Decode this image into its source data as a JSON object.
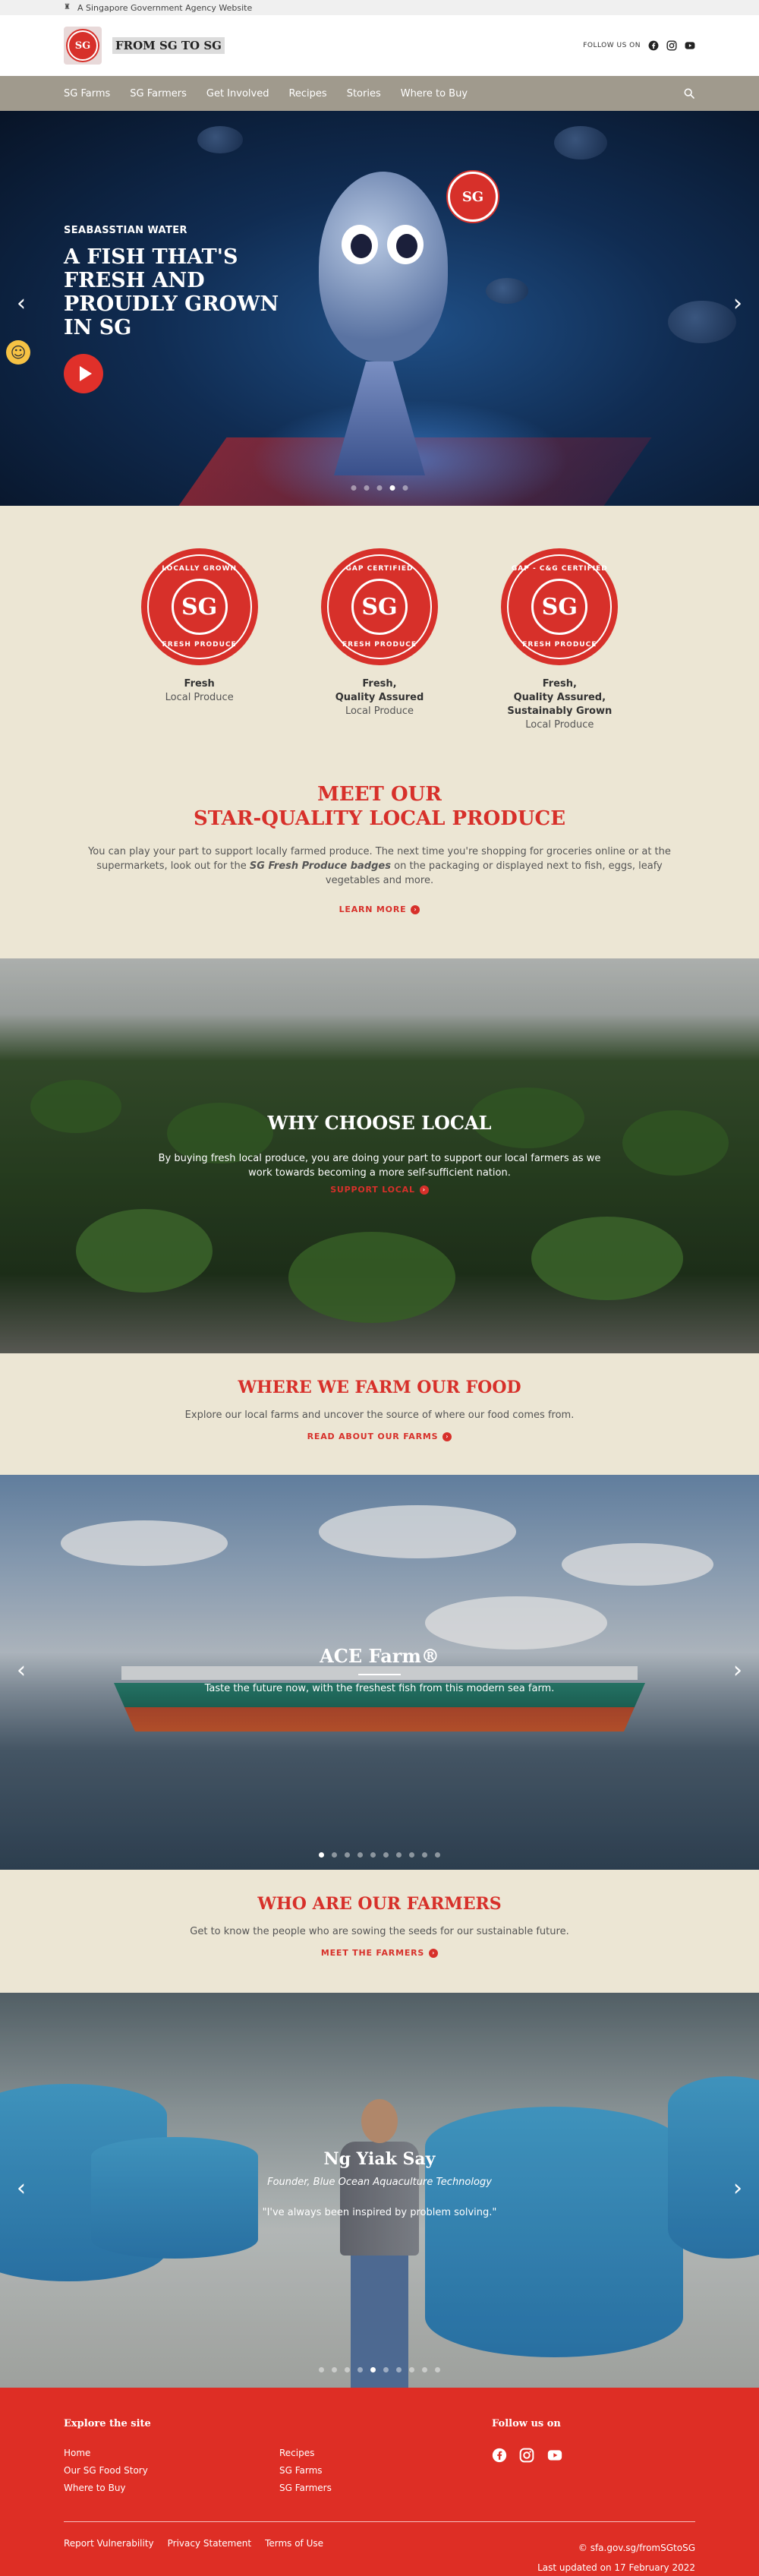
{
  "gov_bar": {
    "text": "A Singapore Government Agency Website"
  },
  "header": {
    "logo_text": "SG",
    "brand_name": "FROM SG TO SG",
    "follow_label": "FOLLOW US ON",
    "social_icons": [
      "facebook-icon",
      "instagram-icon",
      "youtube-icon"
    ]
  },
  "nav": {
    "items": [
      "SG Farms",
      "SG Farmers",
      "Get Involved",
      "Recipes",
      "Stories",
      "Where to Buy"
    ],
    "search_icon": "search-icon"
  },
  "hero": {
    "kicker": "SEABASSTIAN WATER",
    "title": "A FISH THAT'S FRESH AND PROUDLY GROWN IN SG",
    "badge_text": "SG",
    "dots": 5,
    "active_dot": 4
  },
  "badges": {
    "items": [
      {
        "ring_top": "LOCALLY GROWN",
        "ring_bottom": "FRESH PRODUCE",
        "center": "SG",
        "title": "Fresh",
        "subtitle": "Local Produce"
      },
      {
        "ring_top": "GAP CERTIFIED",
        "ring_bottom": "FRESH PRODUCE",
        "center": "SG",
        "title": "Fresh,\nQuality Assured",
        "subtitle": "Local Produce"
      },
      {
        "ring_top": "GAP - C&G CERTIFIED",
        "ring_bottom": "FRESH PRODUCE",
        "center": "SG",
        "title": "Fresh,\nQuality Assured,\nSustainably Grown",
        "subtitle": "Local Produce"
      }
    ],
    "meet_title_1": "MEET OUR",
    "meet_title_2": "STAR-QUALITY LOCAL PRODUCE",
    "meet_desc_1": "You can play your part to support locally farmed produce. The next time you're shopping for groceries online or at the supermarkets, look out for the ",
    "meet_desc_em": "SG Fresh Produce badges",
    "meet_desc_2": " on the packaging or displayed next to fish, eggs, leafy vegetables and more.",
    "cta": "LEARN MORE"
  },
  "why": {
    "title": "WHY CHOOSE LOCAL",
    "desc": "By buying fresh local produce, you are doing your part to support our local farmers as we work towards becoming a more self-sufficient nation.",
    "cta": "SUPPORT LOCAL"
  },
  "farm": {
    "title": "WHERE WE FARM OUR FOOD",
    "desc": "Explore our local farms and uncover the source of where our food comes from.",
    "cta": "READ ABOUT OUR FARMS"
  },
  "ace": {
    "title": "ACE Farm®",
    "desc": "Taste the future now, with the freshest fish from this modern sea farm.",
    "dots": 10,
    "active_dot": 1
  },
  "farmers": {
    "title": "WHO ARE OUR FARMERS",
    "desc": "Get to know the people who are sowing the seeds for our sustainable future.",
    "cta": "MEET THE FARMERS"
  },
  "farmer_slide": {
    "name": "Ng Yiak Say",
    "role": "Founder, Blue Ocean Aquaculture Technology",
    "quote": "\"I've always been inspired by problem solving.\"",
    "dots": 10,
    "active_dot": 5
  },
  "footer": {
    "explore_title": "Explore the site",
    "links": [
      "Home",
      "Recipes",
      "Our SG Food Story",
      "SG Farms",
      "Where to Buy",
      "SG Farmers"
    ],
    "follow_title": "Follow us on",
    "social_icons": [
      "facebook-icon",
      "instagram-icon",
      "youtube-icon"
    ],
    "legal": [
      "Report Vulnerability",
      "Privacy Statement",
      "Terms of Use"
    ],
    "copyright": "© sfa.gov.sg/fromSGtoSG",
    "updated": "Last updated on 17 February 2022"
  },
  "colors": {
    "brand_red": "#d7302a",
    "nav_bg": "#a09a8d",
    "cream": "#ece6d4",
    "footer_red": "#de2e25"
  }
}
